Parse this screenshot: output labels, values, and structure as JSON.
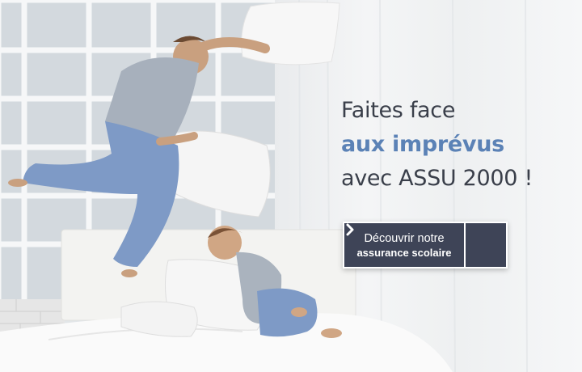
{
  "hero": {
    "headline_line1": "Faites face",
    "headline_accent": "aux imprévus",
    "headline_line3": "avec ASSU 2000  !",
    "accent_color": "#5b82b6",
    "text_color": "#3a3f4a"
  },
  "cta": {
    "line1": "Découvrir notre",
    "line2": "assurance scolaire",
    "icon": "chevron-right-icon",
    "background": "#3e4457"
  }
}
